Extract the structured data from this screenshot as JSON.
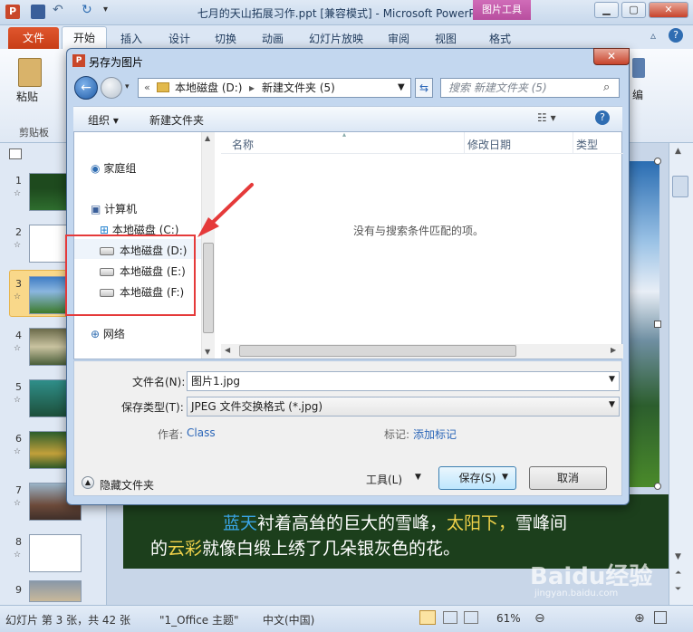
{
  "app": {
    "title": "七月的天山拓展习作.ppt [兼容模式] - Microsoft PowerPoint",
    "picture_tools": "图片工具",
    "logo": "P"
  },
  "ribbon": {
    "tabs": [
      "文件",
      "开始",
      "插入",
      "设计",
      "切换",
      "动画",
      "幻灯片放映",
      "审阅",
      "视图",
      "格式"
    ],
    "paste_label": "粘贴",
    "clipboard_label": "剪贴板",
    "edit_label": "编"
  },
  "slides": {
    "numbers": [
      "1",
      "2",
      "3",
      "4",
      "5",
      "6",
      "7",
      "8",
      "9"
    ],
    "star": "☆"
  },
  "slide_text": {
    "part1": "蓝天",
    "part2": "衬着高耸的巨大的雪峰，",
    "part3": "太阳下，",
    "part4": "雪峰间",
    "part5": "的",
    "part6": "云彩",
    "part7": "就像白缎上绣了几朵银灰色的花。"
  },
  "status": {
    "slide_info": "幻灯片 第 3 张，共 42 张",
    "theme": "\"1_Office 主题\"",
    "language": "中文(中国)",
    "zoom": "61%",
    "watermark": "Baidu经验",
    "watermark_url": "jingyan.baidu.com"
  },
  "dialog": {
    "title": "另存为图片",
    "address": {
      "part1": "本地磁盘 (D:)",
      "part2": "新建文件夹 (5)"
    },
    "search_placeholder": "搜索 新建文件夹 (5)",
    "toolbar": {
      "organize": "组织 ▾",
      "new_folder": "新建文件夹"
    },
    "nav": {
      "homegroup": "家庭组",
      "computer": "计算机",
      "drives": [
        "本地磁盘 (C:)",
        "本地磁盘 (D:)",
        "本地磁盘 (E:)",
        "本地磁盘 (F:)"
      ],
      "network": "网络"
    },
    "columns": {
      "name": "名称",
      "modified": "修改日期",
      "type": "类型"
    },
    "empty_message": "没有与搜索条件匹配的项。",
    "filename_label": "文件名(N):",
    "filename_value": "图片1.jpg",
    "filetype_label": "保存类型(T):",
    "filetype_value": "JPEG 文件交换格式 (*.jpg)",
    "author_label": "作者:",
    "author_value": "Class",
    "tags_label": "标记:",
    "tags_value": "添加标记",
    "hide_folders": "隐藏文件夹",
    "tools": "工具(L)",
    "save": "保存(S)",
    "cancel": "取消"
  },
  "colors": {
    "highlight_red": "#e53a3a",
    "slide_text_blue": "#3aa6e8",
    "slide_text_yellow": "#f0d24a",
    "slide_bg": "#1c3f1c"
  }
}
